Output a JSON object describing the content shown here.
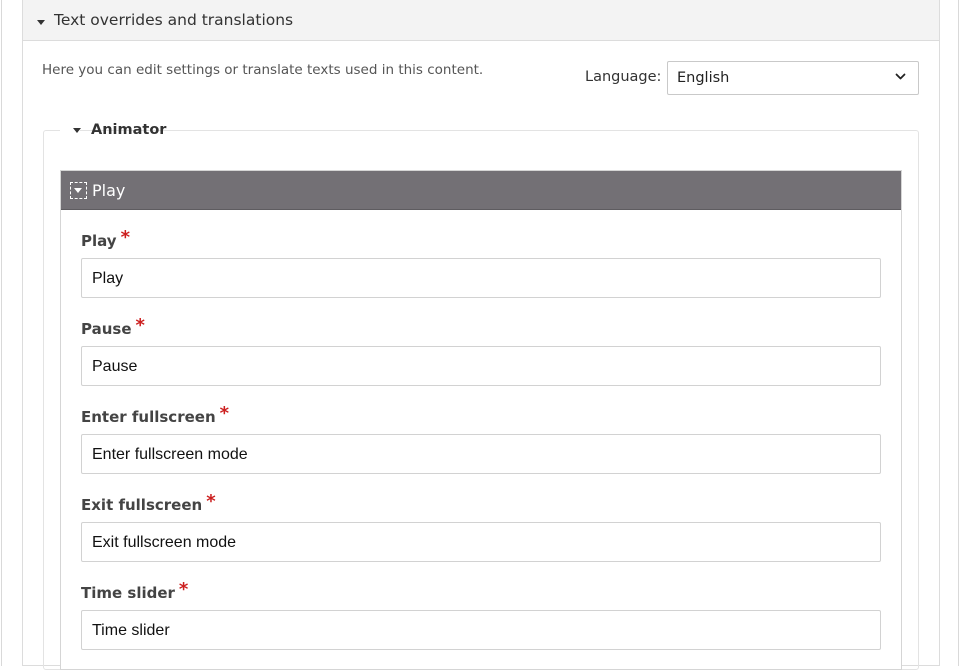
{
  "overrides": {
    "title": "Text overrides and translations",
    "help_text": "Here you can edit settings or translate texts used in this content.",
    "language_label": "Language:",
    "language_value": "English"
  },
  "animator": {
    "title": "Animator"
  },
  "play_group": {
    "title": "Play",
    "fields": [
      {
        "label": "Play",
        "required_mark": "*",
        "value": "Play"
      },
      {
        "label": "Pause",
        "required_mark": "*",
        "value": "Pause"
      },
      {
        "label": "Enter fullscreen",
        "required_mark": "*",
        "value": "Enter fullscreen mode"
      },
      {
        "label": "Exit fullscreen",
        "required_mark": "*",
        "value": "Exit fullscreen mode"
      },
      {
        "label": "Time slider",
        "required_mark": "*",
        "value": "Time slider"
      }
    ]
  },
  "colors": {
    "group_header_bg": "#737075",
    "required": "#cc1f1f",
    "panel_header_bg": "#f3f3f3"
  },
  "icons": {
    "overrides_toggle": "caret-down-icon",
    "animator_toggle": "caret-down-icon",
    "group_toggle": "dashed-caret-icon",
    "language_dropdown": "chevron-down-icon"
  }
}
